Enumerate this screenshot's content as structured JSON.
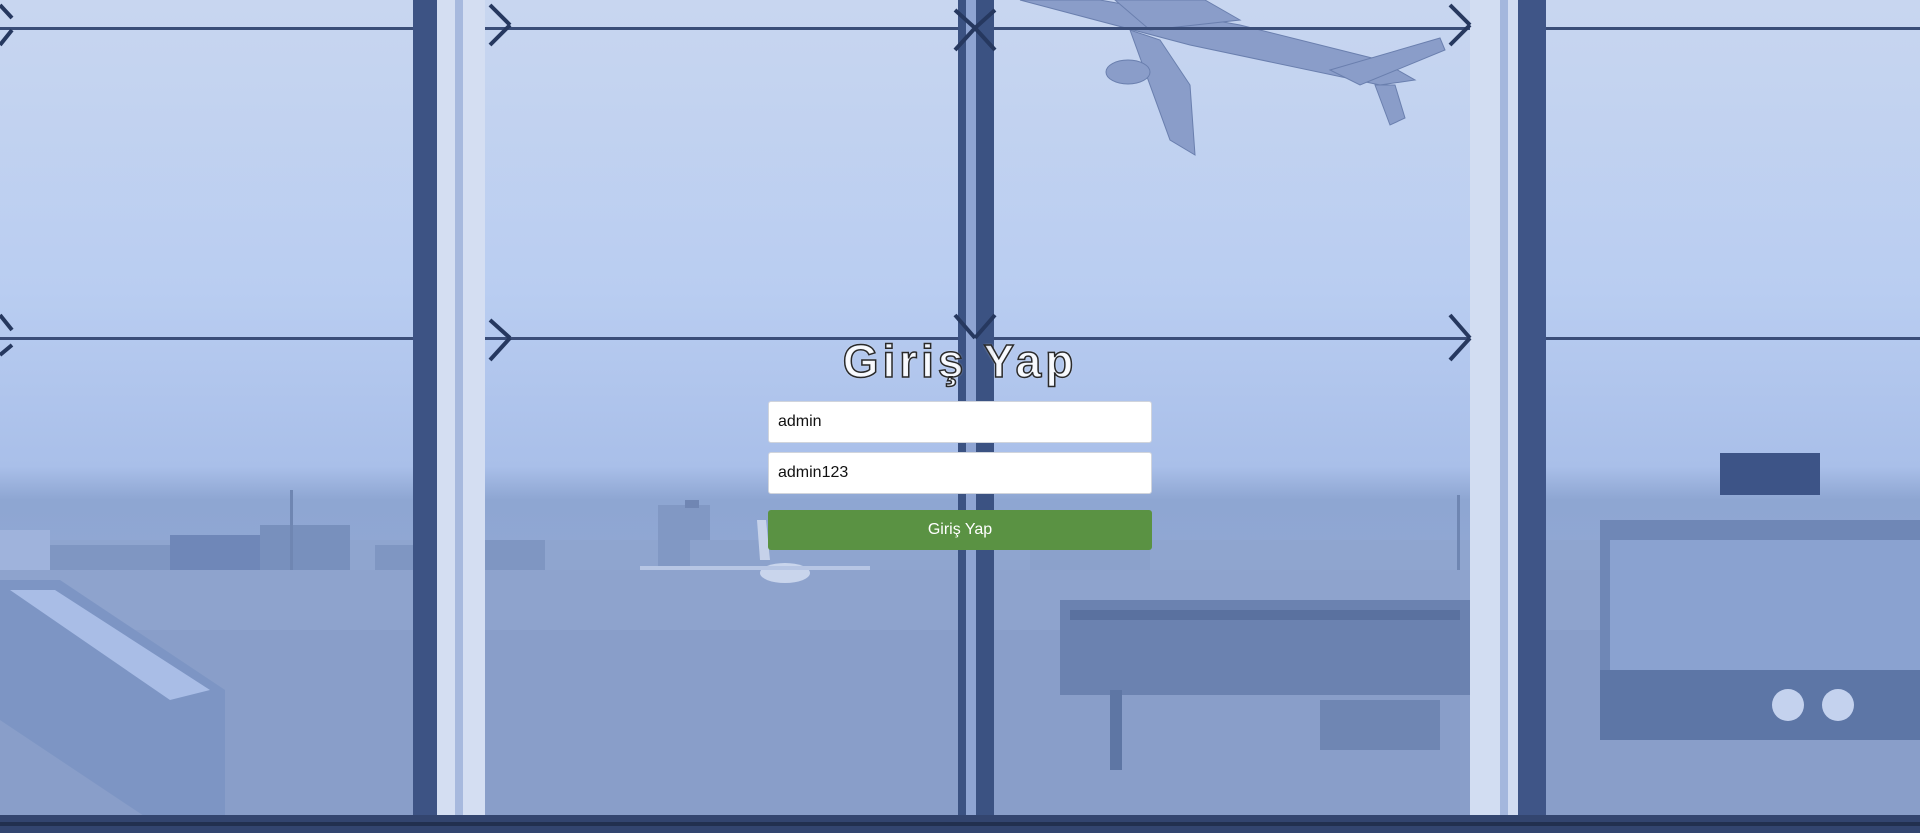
{
  "login": {
    "title": "Giriş Yap",
    "username_value": "admin",
    "password_value": "admin123",
    "submit_label": "Giriş Yap"
  },
  "colors": {
    "submit_button": "#5a9243",
    "background_tint": "#b9cdf1"
  }
}
